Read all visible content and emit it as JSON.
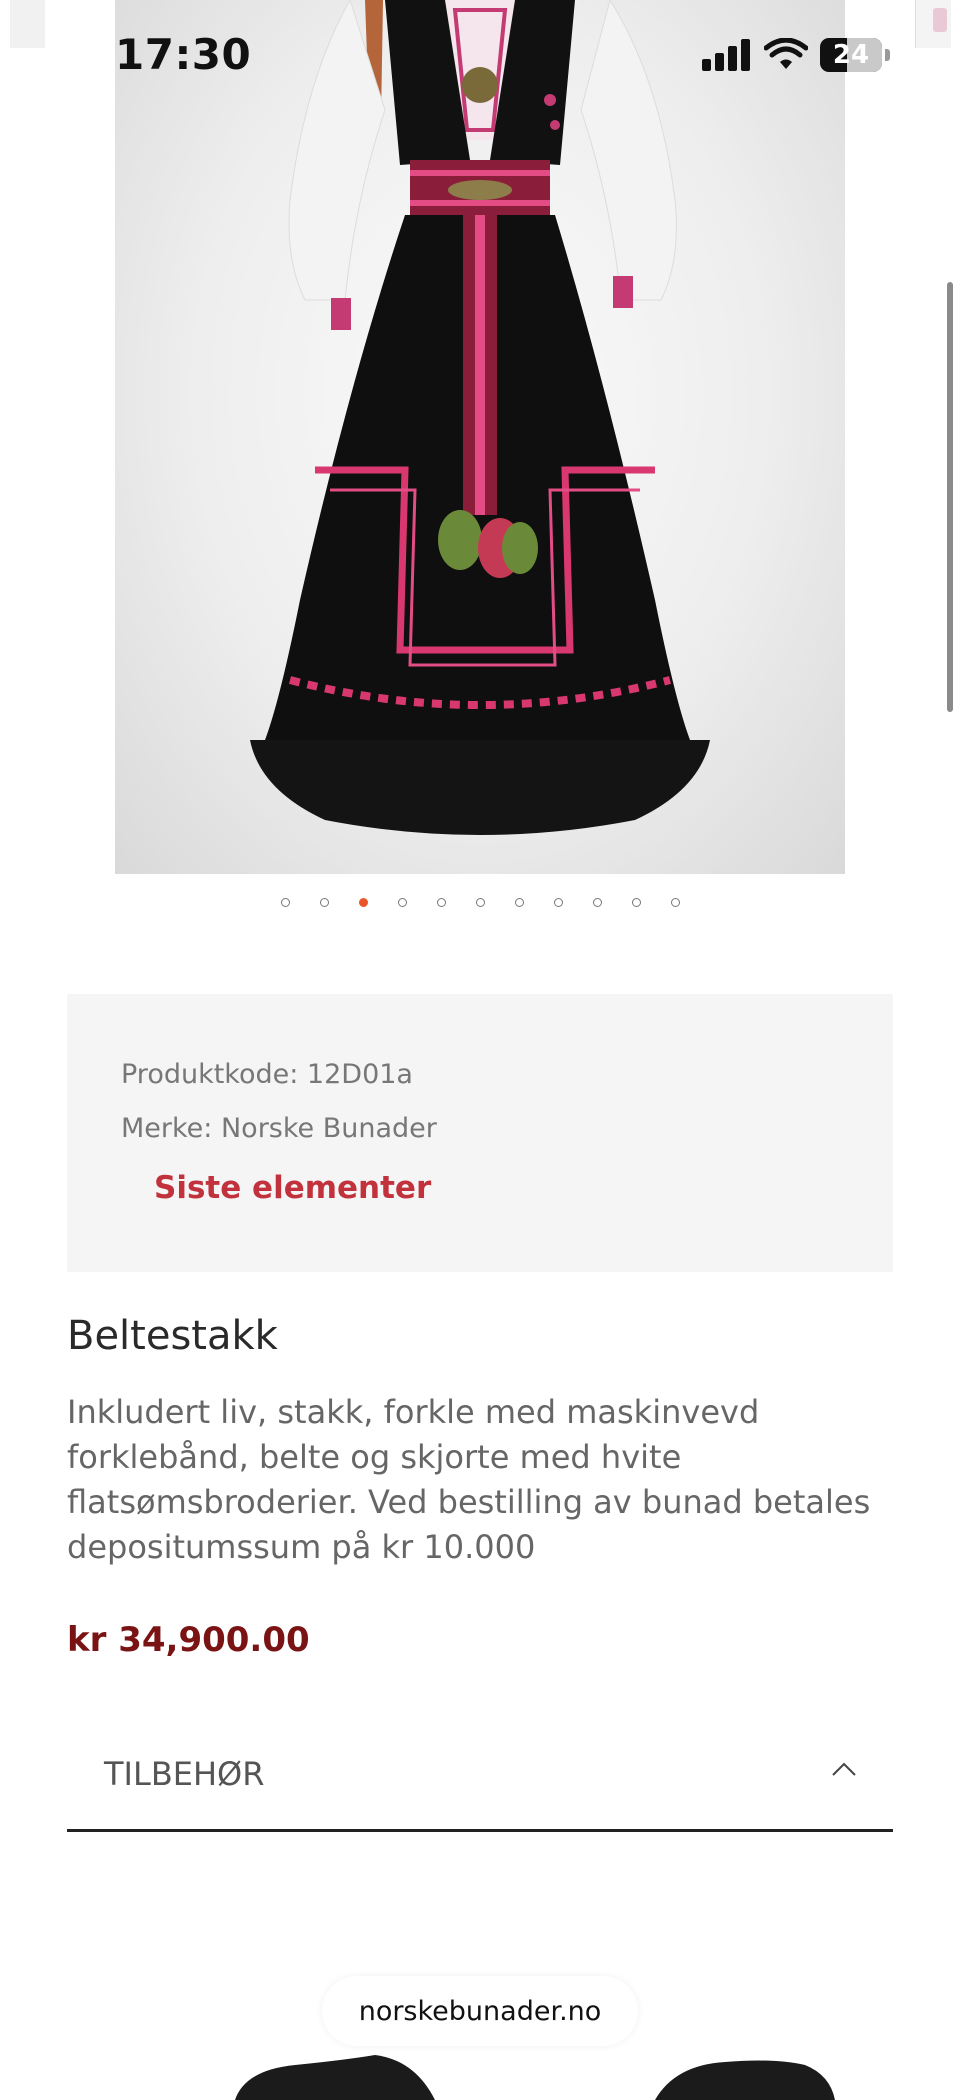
{
  "status_bar": {
    "time": "17:30",
    "battery_level": "24"
  },
  "carousel": {
    "dot_count": 11,
    "active_index": 2,
    "accent": "#e8562a"
  },
  "product_meta": {
    "code_label": "Produktkode: 12D01a",
    "brand_label": "Merke: Norske Bunader",
    "stock_status": "Siste elementer"
  },
  "product": {
    "name": "Beltestakk",
    "description": "Inkludert liv, stakk, forkle med maskinvevd forklebånd, belte og skjorte med hvite flatsømsbroderier. Ved bestilling av bunad betales depositumssum på kr 10.000",
    "price": "kr 34,900.00"
  },
  "accessories": {
    "title": "TILBEHØR",
    "icon": "chevron-up-icon"
  },
  "browser": {
    "domain": "norskebunader.no"
  },
  "colors": {
    "price": "#7a1414",
    "stock": "#c2323d"
  }
}
